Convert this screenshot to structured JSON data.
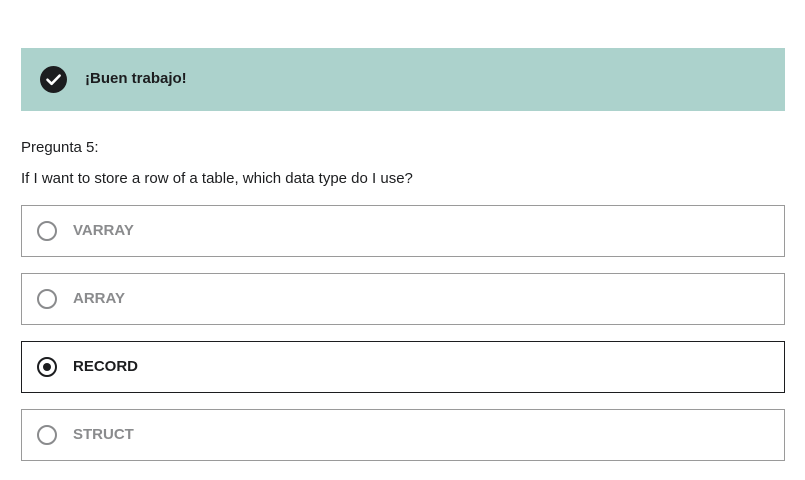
{
  "feedback": {
    "icon": "check-circle-icon",
    "message": "¡Buen trabajo!",
    "background_color": "#acd2cc"
  },
  "question": {
    "number_label": "Pregunta 5:",
    "text": "If I want to store a row of a table, which data type do I use?"
  },
  "options": [
    {
      "label": "VARRAY",
      "selected": false
    },
    {
      "label": "ARRAY",
      "selected": false
    },
    {
      "label": "RECORD",
      "selected": true
    },
    {
      "label": "STRUCT",
      "selected": false
    }
  ]
}
